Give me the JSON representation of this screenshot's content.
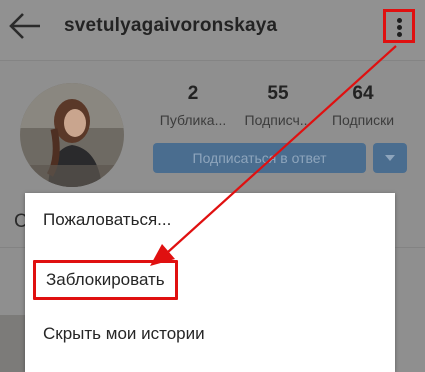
{
  "header": {
    "username": "svetulyagaivoronskaya",
    "back_icon": "arrow-left-icon",
    "more_icon": "more-vertical-icon"
  },
  "profile": {
    "stats": [
      {
        "value": "2",
        "label": "Публика..."
      },
      {
        "value": "55",
        "label": "Подписч..."
      },
      {
        "value": "64",
        "label": "Подписки"
      }
    ],
    "follow_back_label": "Подписаться в ответ",
    "dropdown_icon": "caret-down-icon",
    "name_initial": "С"
  },
  "menu": {
    "items": [
      {
        "label": "Пожаловаться..."
      },
      {
        "label": "Заблокировать"
      },
      {
        "label": "Скрыть мои истории"
      }
    ]
  },
  "annotation": {
    "color": "#e01010"
  }
}
